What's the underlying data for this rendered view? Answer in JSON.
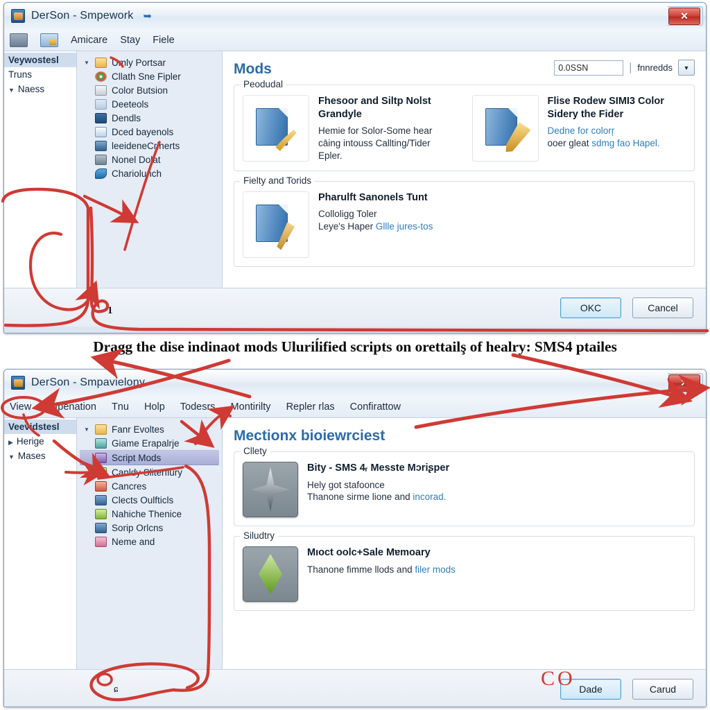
{
  "caption": "Dragg the dise indinaot mods Uluriĺified scripts on orettailş of healry:  SMS4 ptailes",
  "window_top": {
    "title": "DerSon - Smpework",
    "title_icon": "app-icon",
    "pin_icon": "pin-icon",
    "close_label": "✕",
    "toolbar": {
      "icon1": "toolbar-icon-grey",
      "icon2": "toolbar-icon-color",
      "menus": [
        "Amicare",
        "Stay",
        "Fiele"
      ]
    },
    "nav": {
      "header": "Veywostesl",
      "items": [
        {
          "label": "Truns",
          "tri": ""
        },
        {
          "label": "Naess",
          "tri": "▼"
        }
      ]
    },
    "tree": [
      {
        "label": "Umly Portsar",
        "icon": "folder-icon",
        "tw": "▼",
        "cls": "f-folder"
      },
      {
        "label": "Cllath Sne Fipler",
        "icon": "chrome-icon",
        "tw": "",
        "cls": "f-chrome"
      },
      {
        "label": "Color Butsion",
        "icon": "window-icon",
        "tw": "",
        "cls": "f-win"
      },
      {
        "label": "Deeteols",
        "icon": "network-icon",
        "tw": "",
        "cls": "f-net"
      },
      {
        "label": "Dendls",
        "icon": "display-icon",
        "tw": "",
        "cls": "f-disp"
      },
      {
        "label": "Dced bayenols",
        "icon": "document-icon",
        "tw": "",
        "cls": "f-doc"
      },
      {
        "label": "leeideneCrinerts",
        "icon": "book-icon",
        "tw": "",
        "cls": "f-blue"
      },
      {
        "label": "Nonel Dolat",
        "icon": "key-icon",
        "tw": "",
        "cls": "f-key"
      },
      {
        "label": "Chariolunch",
        "icon": "wave-icon",
        "tw": "",
        "cls": "f-wave"
      }
    ],
    "content": {
      "heading": "Mods",
      "combo": {
        "value": "0.0SSN",
        "placeholder": "0.0SSN",
        "separator": "|",
        "label": "fnnredds",
        "arrow": "▼"
      },
      "groups": [
        {
          "legend": "Peodudal",
          "items": [
            {
              "icon": "folder-trowel-icon",
              "title": "Fhesoor and Siltp Nolst Grandyle",
              "desc_lines": [
                {
                  "text": "Hemie for Solor-Some hear",
                  "link": ""
                },
                {
                  "text": "cāing intouss Callting/Tider",
                  "link": ""
                },
                {
                  "text": "Epler.",
                  "link": ""
                }
              ]
            },
            {
              "icon": "folder-pen-icon",
              "title": "Flise Rodew SIMI3 Color Sidery the Fider",
              "desc_lines": [
                {
                  "text": "",
                  "link": "Dedne for colorŗ"
                },
                {
                  "text": "ooer gleat ",
                  "link": "sdmg fao Hapel."
                }
              ]
            }
          ]
        },
        {
          "legend": "Fielty and Torids",
          "items": [
            {
              "icon": "folder-brush-icon",
              "title": "Pharulft Sanonels Tunt",
              "desc_lines": [
                {
                  "text": "Colloligɡ Toler",
                  "link": ""
                },
                {
                  "text": "Leye's Haper ",
                  "link": "Gllle jures-tos"
                }
              ]
            }
          ]
        }
      ]
    },
    "footer": {
      "ok": "OKC",
      "cancel": "Cancel"
    }
  },
  "window_bottom": {
    "title": "DerSon - Smpavielony",
    "title_icon": "app-icon",
    "close_label": "✕",
    "menus": [
      "View",
      "Infpenation",
      "Tnu",
      "Holp",
      "Todesrs",
      "Montirilty",
      "Repler rlas",
      "Confirattow"
    ],
    "nav": {
      "header": "Veevidstesl",
      "items": [
        {
          "label": "Herige",
          "tri": "▶"
        },
        {
          "label": "Mases",
          "tri": "▼"
        }
      ]
    },
    "tree": [
      {
        "label": "Fanr Evoltes",
        "icon": "folder-icon",
        "tw": "▼",
        "cls": "f-folder",
        "sel": false
      },
      {
        "label": "Giame Erapalrje",
        "icon": "settings-icon",
        "tw": "",
        "cls": "f-teal",
        "sel": false
      },
      {
        "label": "Script Mods",
        "icon": "script-icon",
        "tw": "",
        "cls": "f-purple",
        "sel": true
      },
      {
        "label": "Canldy Sliterfiury",
        "icon": "candy-icon",
        "tw": "",
        "cls": "f-green",
        "sel": false
      },
      {
        "label": "Cancres",
        "icon": "gift-icon",
        "tw": "",
        "cls": "f-red",
        "sel": false
      },
      {
        "label": "Clects Oulfticls",
        "icon": "globe-icon",
        "tw": "",
        "cls": "f-blue",
        "sel": false
      },
      {
        "label": "Nahiche Thenice",
        "icon": "image-icon",
        "tw": "",
        "cls": "f-green",
        "sel": false
      },
      {
        "label": "Sorip Orlcns",
        "icon": "person-icon",
        "tw": "",
        "cls": "f-blue",
        "sel": false
      },
      {
        "label": "Neme and",
        "icon": "media-icon",
        "tw": "",
        "cls": "f-pink",
        "sel": false
      }
    ],
    "content": {
      "heading": "Mectionx bioiewrciest",
      "groups": [
        {
          "legend": "Cllety",
          "items": [
            {
              "icon": "star-tile-icon",
              "title": "Bity - SMS 4ᵣ Messte Mɔriʂper",
              "desc_lines": [
                {
                  "text": "Hely got stafoonce",
                  "link": ""
                },
                {
                  "text": "Thanone sirme lione and ",
                  "link": "incorad."
                }
              ]
            }
          ]
        },
        {
          "legend": "Siludtry",
          "items": [
            {
              "icon": "plumbob-tile-icon",
              "title": "Mıoct oolc+Sale Mɐmoary",
              "desc_lines": [
                {
                  "text": "Thanone fimme llods and ",
                  "link": "filer mods"
                }
              ]
            }
          ]
        }
      ]
    },
    "footer": {
      "ok": "Dade",
      "cancel": "Carud",
      "status": "ɕ"
    }
  },
  "annotations": {
    "number_label": "1",
    "co_label": "CO",
    "color": "#cf3a34"
  }
}
